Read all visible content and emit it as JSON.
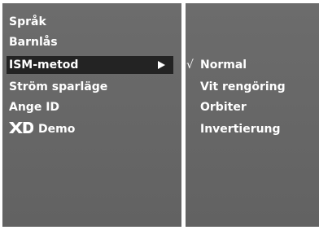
{
  "menu": {
    "items": [
      {
        "label": "Språk"
      },
      {
        "label": "Barnlås"
      },
      {
        "label": "ISM-metod",
        "selected": true
      },
      {
        "label": "Ström sparläge"
      },
      {
        "label": "Ange ID"
      },
      {
        "label": "Demo",
        "icon": "xd-logo-icon"
      }
    ]
  },
  "submenu": {
    "check_mark": "√",
    "items": [
      {
        "label": "Normal",
        "checked": true
      },
      {
        "label": "Vit rengöring"
      },
      {
        "label": "Orbiter"
      },
      {
        "label": "Invertierung"
      }
    ]
  },
  "colors": {
    "panel": "#666666",
    "highlight": "#232323",
    "text": "#ffffff",
    "background": "#ffffff"
  }
}
